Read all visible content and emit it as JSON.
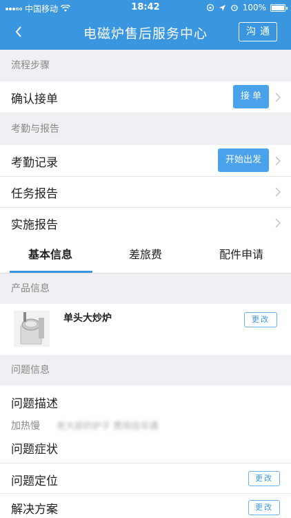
{
  "status_bar": {
    "carrier": "中国移动",
    "time": "18:42",
    "battery": "100%"
  },
  "nav": {
    "title": "电磁炉售后服务中心",
    "chat_label": "沟通"
  },
  "process": {
    "header": "流程步骤",
    "confirm_label": "确认接单",
    "accept_button": "接单"
  },
  "attendance": {
    "header": "考勤与报告",
    "items": [
      {
        "label": "考勤记录",
        "button": "开始出发"
      },
      {
        "label": "任务报告"
      },
      {
        "label": "实施报告"
      }
    ]
  },
  "tabs": [
    {
      "label": "基本信息",
      "active": true
    },
    {
      "label": "差旅费",
      "active": false
    },
    {
      "label": "配件申请",
      "active": false
    }
  ],
  "product": {
    "header": "产品信息",
    "name": "单头大炒炉",
    "change_button": "更改"
  },
  "problem": {
    "header": "问题信息",
    "description_title": "问题描述",
    "description_tag": "加热慢",
    "description_text": "老大部的炉子 费用挂华通",
    "symptom_title": "问题症状",
    "location_title": "问题定位",
    "location_change": "更改",
    "solution_title": "解决方案",
    "solution_change": "更改"
  }
}
